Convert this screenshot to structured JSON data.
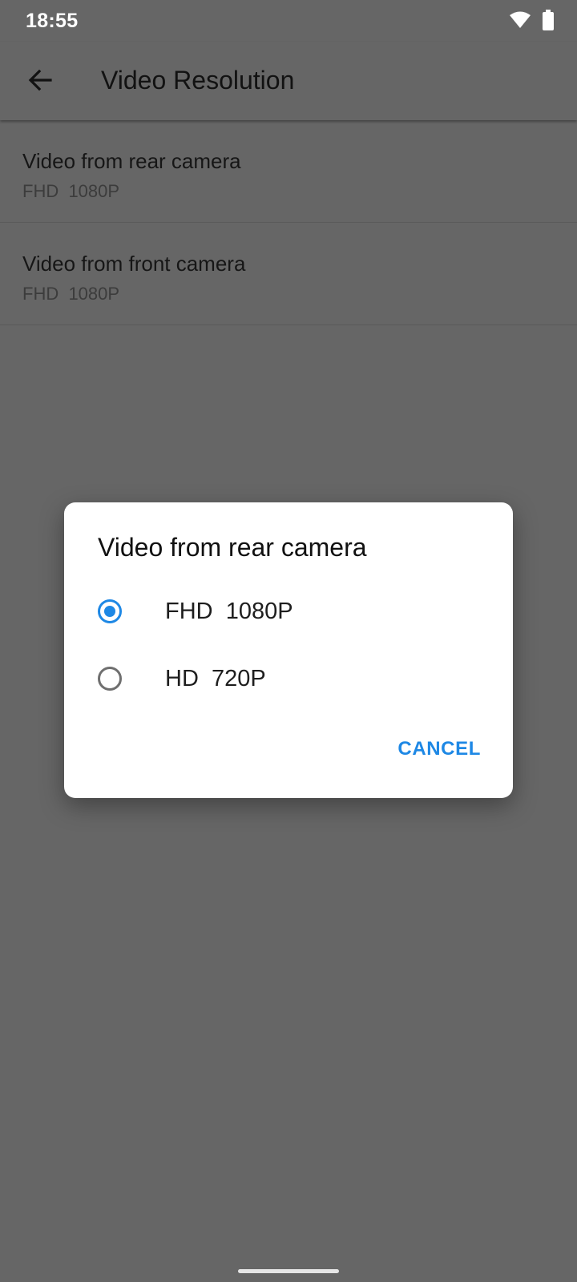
{
  "status_bar": {
    "time": "18:55",
    "icons": [
      "wifi-icon",
      "battery-icon"
    ]
  },
  "app_bar": {
    "title": "Video Resolution",
    "back_icon": "arrow-left-icon"
  },
  "list": {
    "items": [
      {
        "title": "Video from rear camera",
        "subtitle": "FHD  1080P"
      },
      {
        "title": "Video from front camera",
        "subtitle": "FHD  1080P"
      }
    ]
  },
  "dialog": {
    "title": "Video from rear camera",
    "options": [
      {
        "label": "FHD  1080P",
        "selected": true
      },
      {
        "label": "HD  720P",
        "selected": false
      }
    ],
    "cancel_label": "CANCEL"
  },
  "colors": {
    "accent": "#1e88e5",
    "scrim_background": "#666666",
    "dialog_background": "#ffffff"
  }
}
